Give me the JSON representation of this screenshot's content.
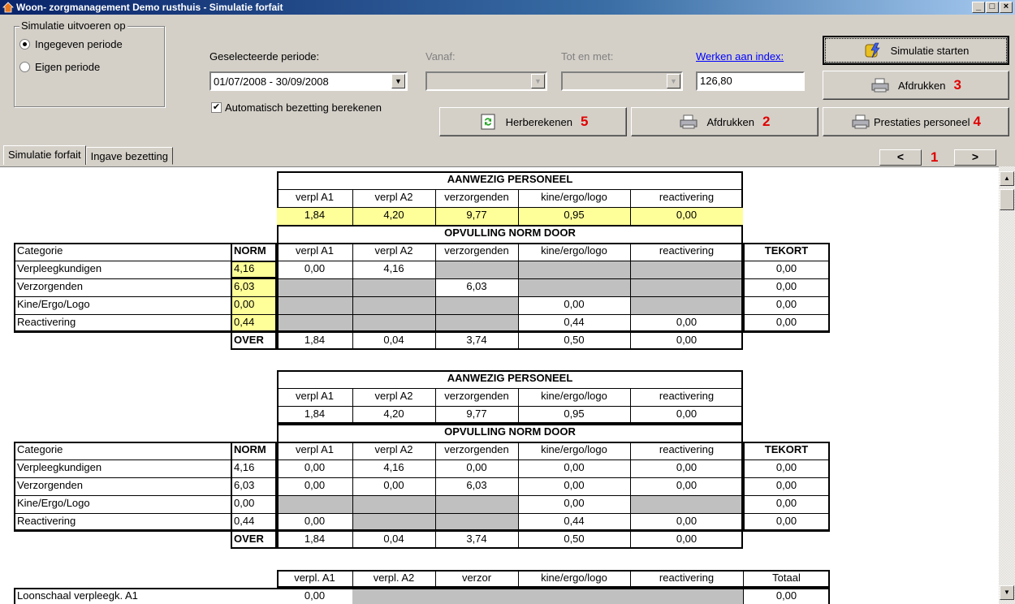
{
  "window": {
    "title": "Woon- zorgmanagement Demo rusthuis - Simulatie forfait"
  },
  "simulatie_group": {
    "title": "Simulatie uitvoeren op",
    "options": [
      "Ingegeven periode",
      "Eigen periode"
    ],
    "selected": "Ingegeven periode"
  },
  "periode": {
    "label": "Geselecteerde periode:",
    "value": "01/07/2008 - 30/09/2008"
  },
  "vanaf": {
    "label": "Vanaf:"
  },
  "totenmet": {
    "label": "Tot en met:"
  },
  "index": {
    "link": "Werken aan index:",
    "value": "126,80"
  },
  "auto_bezetting": {
    "label": "Automatisch bezetting berekenen",
    "checked": true
  },
  "buttons": {
    "simulatie_starten": "Simulatie starten",
    "afdrukken3": "Afdrukken",
    "afdrukken3_num": "3",
    "herberekenen": "Herberekenen",
    "herberekenen_num": "5",
    "afdrukken2": "Afdrukken",
    "afdrukken2_num": "2",
    "prestaties": "Prestaties personeel",
    "prestaties_num": "4"
  },
  "tabs": [
    "Simulatie forfait",
    "Ingave bezetting"
  ],
  "nav": {
    "prev": "<",
    "next": ">",
    "num": "1"
  },
  "icons": {
    "app": "house-icon",
    "printer": "printer-icon",
    "refresh": "refresh-icon",
    "start": "lightning-drum-icon"
  },
  "colors": {
    "yellow": "#ffff99",
    "gray": "#c0c0c0",
    "red_annotation": "#e00000"
  },
  "aanwezig_header": "AANWEZIG PERSONEEL",
  "opvulling_header": "OPVULLING NORM DOOR",
  "staff_cols": [
    "verpl A1",
    "verpl A2",
    "verzorgenden",
    "kine/ergo/logo",
    "reactivering"
  ],
  "table1": {
    "aanwezig": [
      "1,84",
      "4,20",
      "9,77",
      "0,95",
      "0,00"
    ],
    "cat_label": "Categorie",
    "norm_label": "NORM",
    "tekort_label": "TEKORT",
    "over_label": "OVER",
    "rows": [
      {
        "cat": "Verpleegkundigen",
        "norm": "4,16",
        "vals": [
          "0,00",
          "4,16",
          "",
          "",
          ""
        ],
        "tekort": "0,00"
      },
      {
        "cat": "Verzorgenden",
        "norm": "6,03",
        "vals": [
          "",
          "",
          "6,03",
          "",
          ""
        ],
        "tekort": "0,00"
      },
      {
        "cat": "Kine/Ergo/Logo",
        "norm": "0,00",
        "vals": [
          "",
          "",
          "",
          "0,00",
          ""
        ],
        "tekort": "0,00"
      },
      {
        "cat": "Reactivering",
        "norm": "0,44",
        "vals": [
          "",
          "",
          "",
          "0,44",
          "0,00"
        ],
        "tekort": "0,00"
      }
    ],
    "over": [
      "1,84",
      "0,04",
      "3,74",
      "0,50",
      "0,00"
    ]
  },
  "table2": {
    "aanwezig": [
      "1,84",
      "4,20",
      "9,77",
      "0,95",
      "0,00"
    ],
    "cat_label": "Categorie",
    "norm_label": "NORM",
    "tekort_label": "TEKORT",
    "over_label": "OVER",
    "rows": [
      {
        "cat": "Verpleegkundigen",
        "norm": "4,16",
        "vals": [
          "0,00",
          "4,16",
          "0,00",
          "0,00",
          "0,00"
        ],
        "tekort": "0,00"
      },
      {
        "cat": "Verzorgenden",
        "norm": "6,03",
        "vals": [
          "0,00",
          "0,00",
          "6,03",
          "0,00",
          "0,00"
        ],
        "tekort": "0,00"
      },
      {
        "cat": "Kine/Ergo/Logo",
        "norm": "0,00",
        "vals": [
          "",
          "",
          "",
          "0,00",
          ""
        ],
        "tekort": "0,00"
      },
      {
        "cat": "Reactivering",
        "norm": "0,44",
        "vals": [
          "0,00",
          "",
          "",
          "0,44",
          "0,00"
        ],
        "tekort": "0,00"
      }
    ],
    "over": [
      "1,84",
      "0,04",
      "3,74",
      "0,50",
      "0,00"
    ]
  },
  "table3": {
    "cols": [
      "verpl. A1",
      "verpl. A2",
      "verzor",
      "kine/ergo/logo",
      "reactivering",
      "Totaal"
    ],
    "row": {
      "cat": "Loonschaal verpleegk. A1",
      "vals": [
        "0,00",
        "",
        "",
        "",
        "",
        "0,00"
      ]
    }
  }
}
